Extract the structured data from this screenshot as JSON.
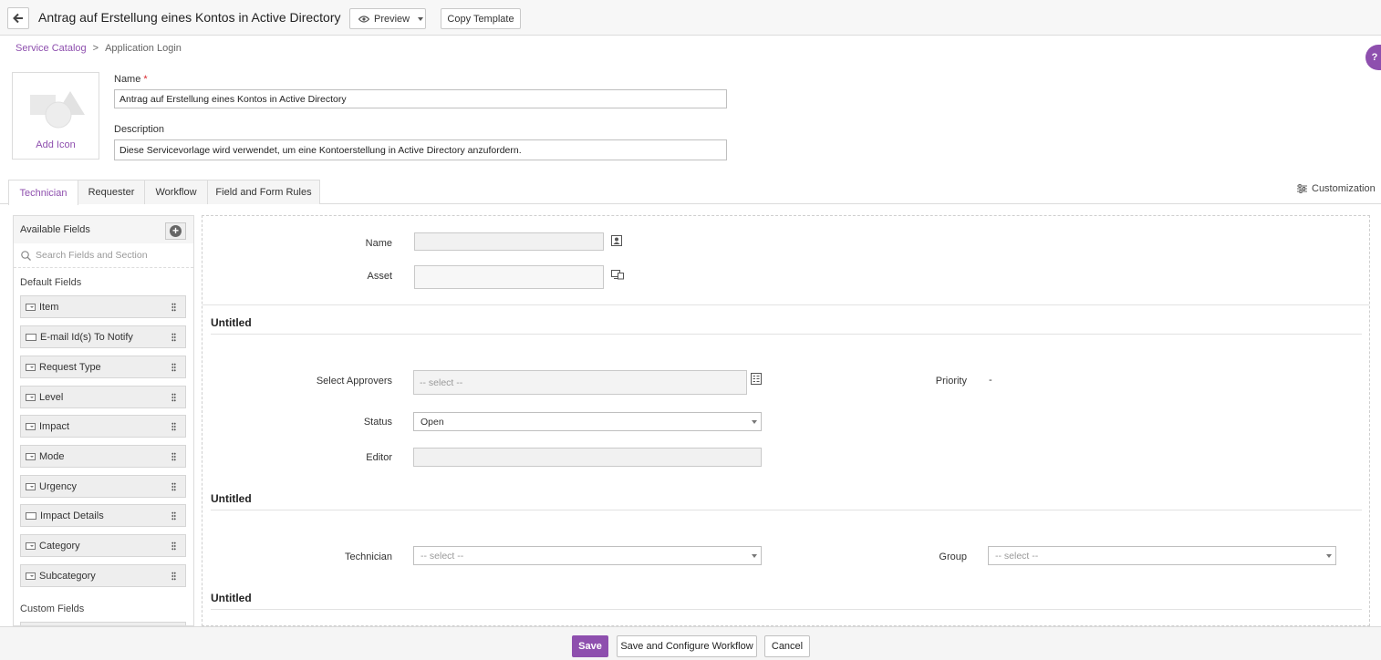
{
  "header": {
    "title": "Antrag auf Erstellung eines Kontos in Active Directory",
    "preview_label": "Preview",
    "copy_template_label": "Copy Template"
  },
  "breadcrumb": {
    "root": "Service Catalog",
    "separator": ">",
    "current": "Application Login"
  },
  "help": {
    "label": "?"
  },
  "icon_box": {
    "label": "Add Icon"
  },
  "form": {
    "name_label": "Name",
    "required_mark": "*",
    "name_value": "Antrag auf Erstellung eines Kontos in Active Directory",
    "description_label": "Description",
    "description_value": "Diese Servicevorlage wird verwendet, um eine Kontoerstellung in Active Directory anzufordern."
  },
  "tabs": [
    {
      "label": "Technician",
      "active": true
    },
    {
      "label": "Requester",
      "active": false
    },
    {
      "label": "Workflow",
      "active": false
    },
    {
      "label": "Field and Form Rules",
      "active": false
    }
  ],
  "customization_label": "Customization",
  "left_panel": {
    "title": "Available Fields",
    "search_placeholder": "Search Fields and Section",
    "default_fields_label": "Default Fields",
    "default_fields": [
      {
        "label": "Item",
        "icon": "dropdown-field-icon"
      },
      {
        "label": "E-mail Id(s) To Notify",
        "icon": "text-field-icon"
      },
      {
        "label": "Request Type",
        "icon": "dropdown-field-icon"
      },
      {
        "label": "Level",
        "icon": "dropdown-field-icon"
      },
      {
        "label": "Impact",
        "icon": "dropdown-field-icon"
      },
      {
        "label": "Mode",
        "icon": "dropdown-field-icon"
      },
      {
        "label": "Urgency",
        "icon": "dropdown-field-icon"
      },
      {
        "label": "Impact Details",
        "icon": "text-field-icon"
      },
      {
        "label": "Category",
        "icon": "dropdown-field-icon"
      },
      {
        "label": "Subcategory",
        "icon": "dropdown-field-icon"
      }
    ],
    "custom_fields_label": "Custom Fields"
  },
  "canvas": {
    "requester_name_label": "Name",
    "asset_label": "Asset",
    "sections": [
      {
        "title": "Untitled",
        "approvers_label": "Select Approvers",
        "approvers_placeholder": "-- select --",
        "priority_label": "Priority",
        "priority_value": "-",
        "status_label": "Status",
        "status_value": "Open",
        "editor_label": "Editor"
      },
      {
        "title": "Untitled",
        "technician_label": "Technician",
        "technician_placeholder": "-- select --",
        "group_label": "Group",
        "group_placeholder": "-- select --"
      },
      {
        "title": "Untitled"
      }
    ]
  },
  "footer": {
    "save_label": "Save",
    "save_configure_label": "Save and Configure Workflow",
    "cancel_label": "Cancel"
  },
  "colors": {
    "accent": "#8e4fae",
    "required": "#d9272d"
  }
}
